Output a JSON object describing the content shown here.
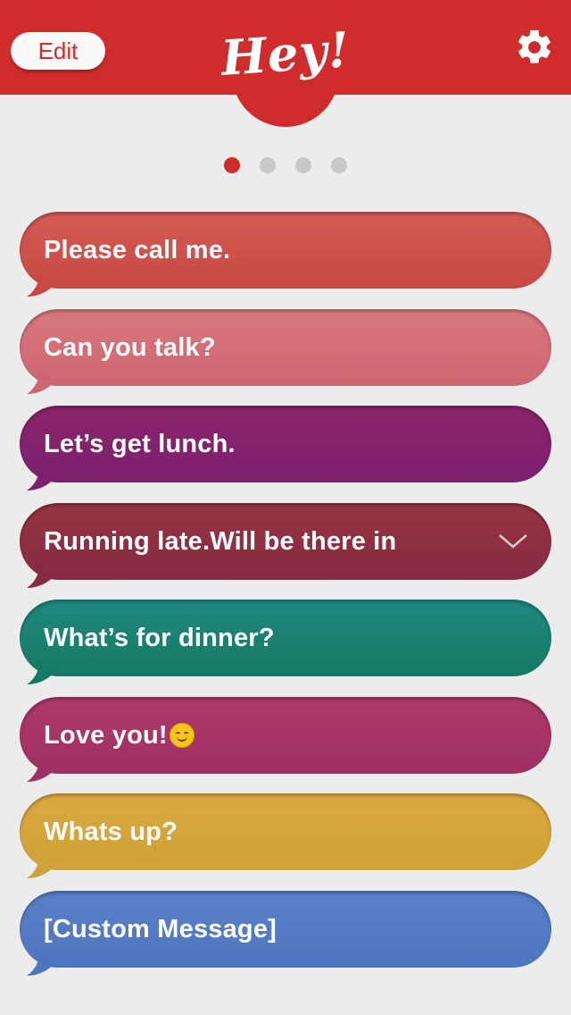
{
  "header": {
    "edit_label": "Edit",
    "logo_text": "Hey!",
    "settings_icon": "gear-icon",
    "bar_color": "#d12c2c"
  },
  "pager": {
    "total": 4,
    "active_index": 0
  },
  "messages": [
    {
      "text": "Please call me.",
      "color_top": "#d45b55",
      "color_bottom": "#c84843"
    },
    {
      "text": "Can you talk?",
      "color_top": "#d9787f",
      "color_bottom": "#cc6670"
    },
    {
      "text": "Let’s get lunch.",
      "color_top": "#8a246c",
      "color_bottom": "#7d1f6d"
    },
    {
      "text": "Running late.Will be there in",
      "color_top": "#953441",
      "color_bottom": "#872a43",
      "has_dropdown": true,
      "dropdown_icon": "chevron-down-icon"
    },
    {
      "text": "What’s for dinner?",
      "color_top": "#1f8880",
      "color_bottom": "#167a63"
    },
    {
      "text": "Love you!",
      "color_top": "#ad3a6a",
      "color_bottom": "#a02f62",
      "emoji": "smiling-face-icon"
    },
    {
      "text": "Whats up?",
      "color_top": "#dba941",
      "color_bottom": "#cfa23a"
    },
    {
      "text": "[Custom Message]",
      "color_top": "#5a80c9",
      "color_bottom": "#4e75bf"
    }
  ]
}
